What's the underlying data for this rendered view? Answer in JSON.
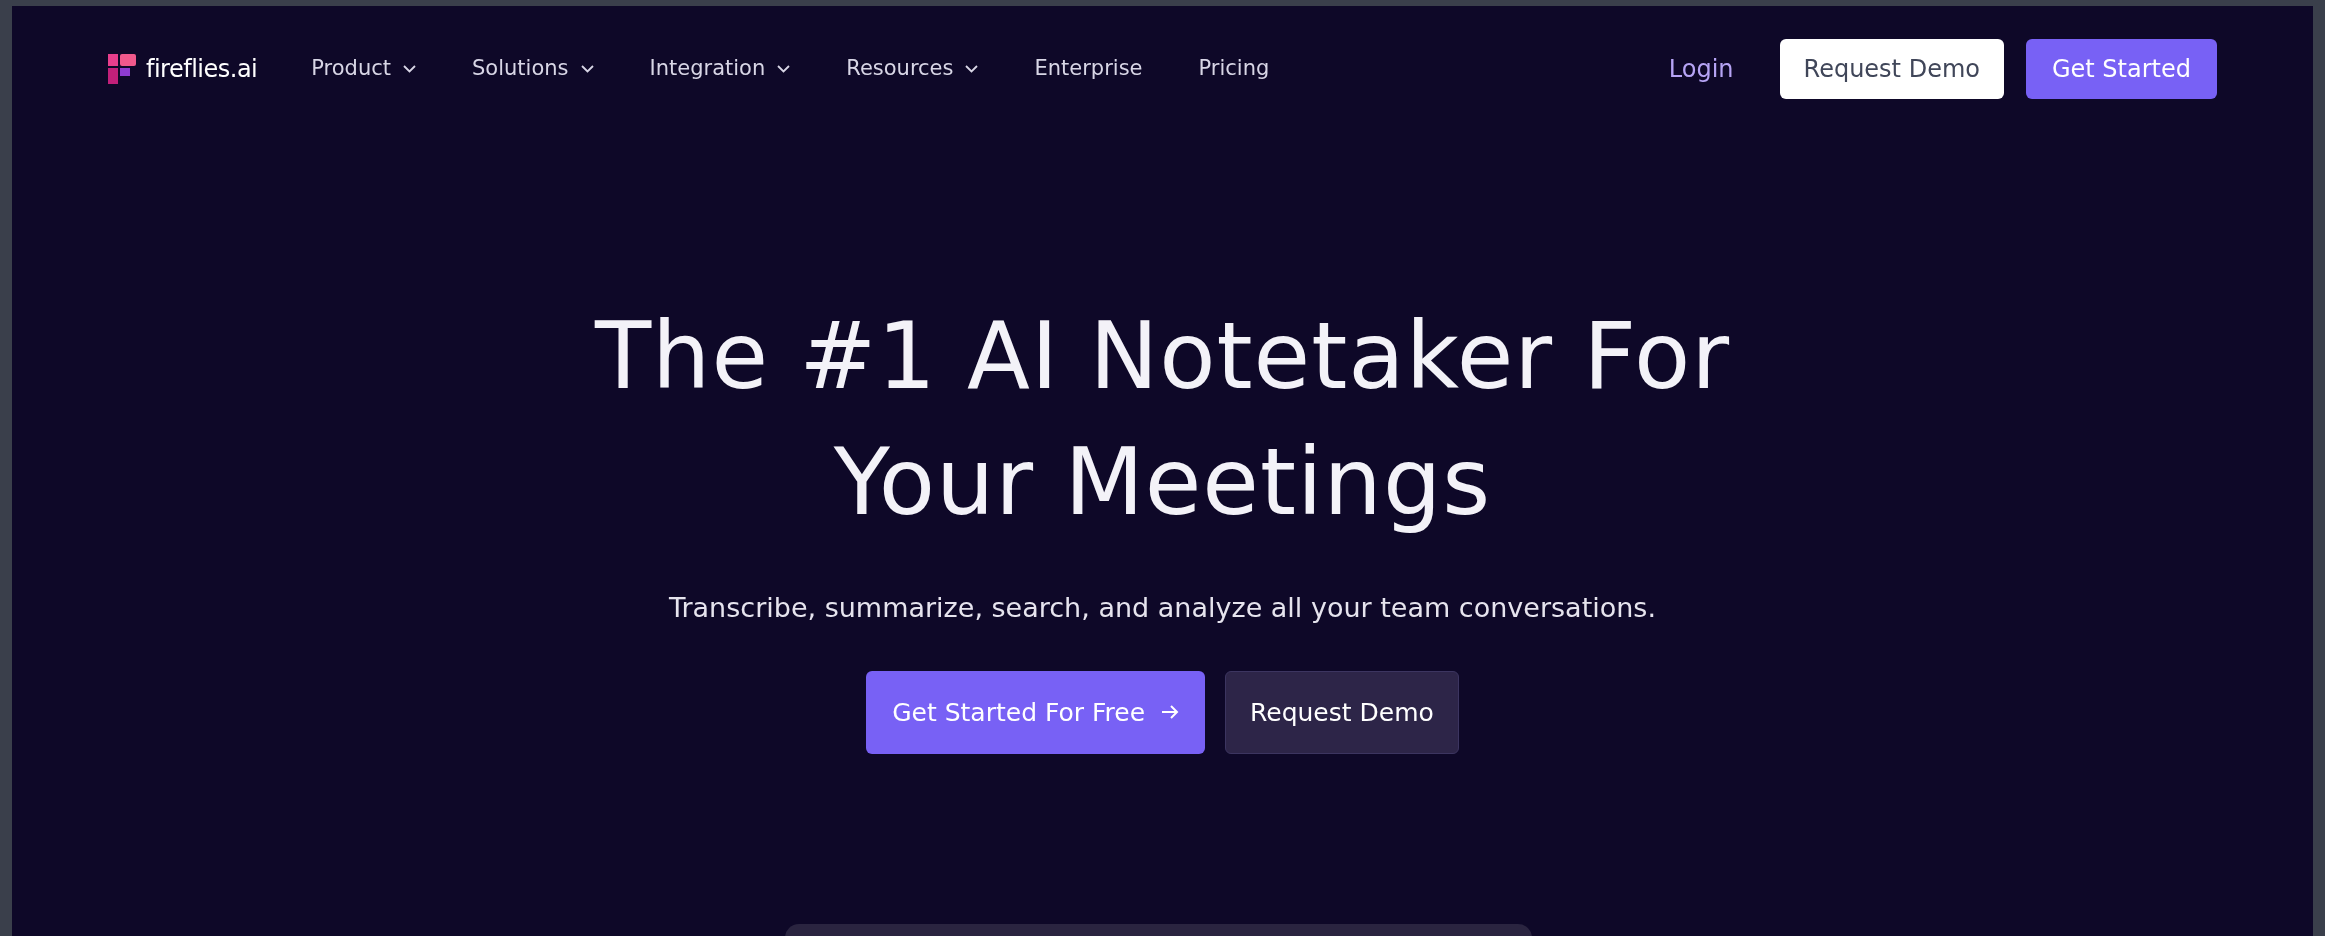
{
  "brand": {
    "name": "fireflies.ai"
  },
  "nav": [
    {
      "label": "Product",
      "dropdown": true
    },
    {
      "label": "Solutions",
      "dropdown": true
    },
    {
      "label": "Integration",
      "dropdown": true
    },
    {
      "label": "Resources",
      "dropdown": true
    },
    {
      "label": "Enterprise",
      "dropdown": false
    },
    {
      "label": "Pricing",
      "dropdown": false
    }
  ],
  "header_actions": [
    {
      "label": "Login",
      "kind": "link"
    },
    {
      "label": "Request Demo",
      "kind": "light"
    },
    {
      "label": "Get Started",
      "kind": "primary"
    }
  ],
  "hero": {
    "title_lines": [
      "The #1 AI Notetaker For",
      "Your Meetings"
    ],
    "subtitle": "Transcribe, summarize, search, and analyze all your team conversations.",
    "buttons": [
      {
        "label": "Get Started For Free",
        "kind": "primary",
        "arrow": true
      },
      {
        "label": "Request Demo",
        "kind": "dark",
        "arrow": false
      }
    ]
  }
}
